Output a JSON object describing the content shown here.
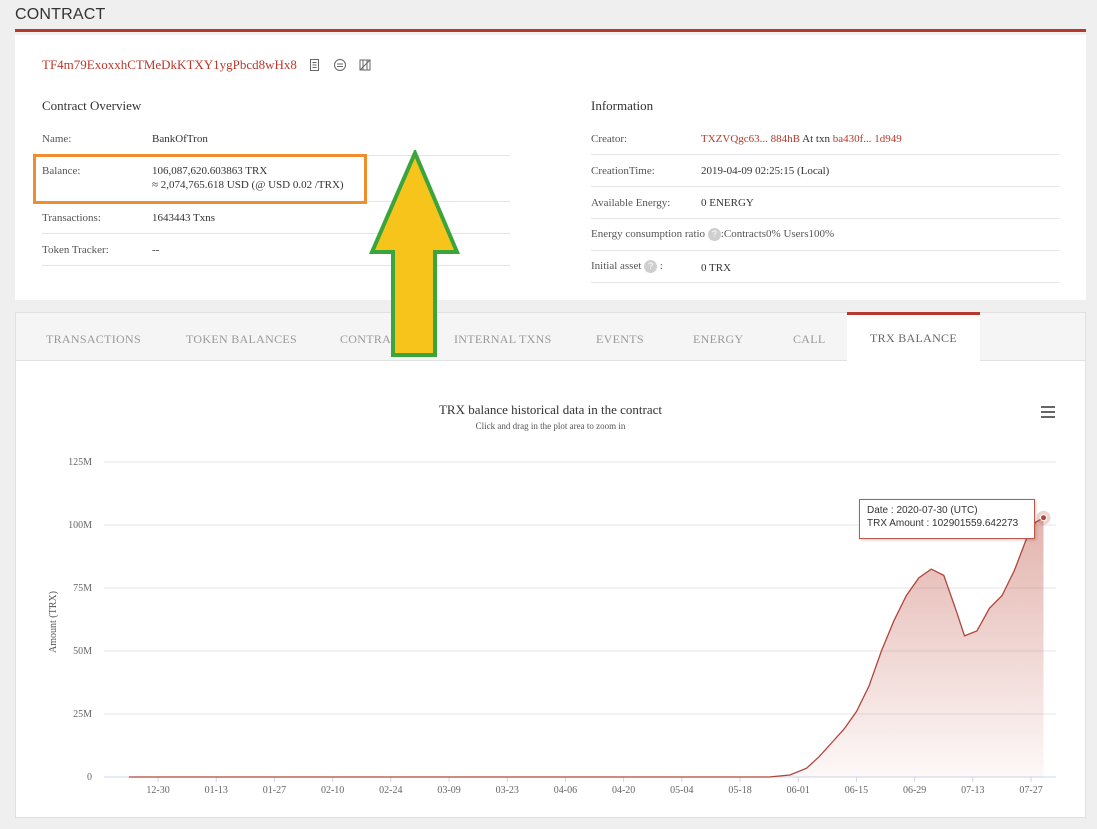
{
  "header": {
    "title": "CONTRACT"
  },
  "contract": {
    "address": "TF4m79ExoxxhCTMeDkKTXY1ygPbcd8wHx8",
    "icons": [
      "copy-icon",
      "qr-code-icon",
      "tag-icon"
    ]
  },
  "overview": {
    "title": "Contract Overview",
    "name_label": "Name:",
    "name_value": "BankOfTron",
    "balance_label": "Balance:",
    "balance_trx": "106,087,620.603863 TRX",
    "balance_usd": "≈ 2,074,765.618 USD (@ USD 0.02 /TRX)",
    "transactions_label": "Transactions:",
    "transactions_value": "1643443  Txns",
    "token_tracker_label": "Token Tracker:",
    "token_tracker_value": "--"
  },
  "information": {
    "title": "Information",
    "creator_label": "Creator:",
    "creator_address": "TXZVQgc63... 884hB",
    "creator_at": "At txn",
    "creator_txn": "ba430f... 1d949",
    "creation_time_label": "CreationTime:",
    "creation_time_value": "2019-04-09 02:25:15 (Local)",
    "energy_label": "Available Energy:",
    "energy_value": "0  ENERGY",
    "ratio_label": "Energy consumption ratio",
    "ratio_value": ":Contracts0%  Users100%",
    "initial_asset_label": "Initial asset",
    "initial_asset_value": "0 TRX"
  },
  "tabs": [
    {
      "label": "TRANSACTIONS"
    },
    {
      "label": "TOKEN BALANCES"
    },
    {
      "label": "CONTRACT"
    },
    {
      "label": "INTERNAL TXNS"
    },
    {
      "label": "EVENTS"
    },
    {
      "label": "ENERGY"
    },
    {
      "label": "CALL"
    },
    {
      "label": "TRX BALANCE"
    }
  ],
  "active_tab": "TRX BALANCE",
  "colors": {
    "accent": "#b8392b",
    "highlight": "#ef8d2f",
    "arrow_fill": "#f7c41c",
    "arrow_stroke": "#3aa53a"
  },
  "chart_data": {
    "type": "area",
    "title": "TRX balance historical data in the contract",
    "subtitle": "Click and drag in the plot area to zoom in",
    "ylabel": "Amount (TRX)",
    "y_ticks": [
      "0",
      "25M",
      "50M",
      "75M",
      "100M",
      "125M"
    ],
    "ylim": [
      0,
      125000000
    ],
    "x_ticks": [
      "12-30",
      "01-13",
      "01-27",
      "02-10",
      "02-24",
      "03-09",
      "03-23",
      "04-06",
      "04-20",
      "05-04",
      "05-18",
      "06-01",
      "06-15",
      "06-29",
      "07-13",
      "07-27"
    ],
    "series": [
      {
        "x": [
          "2019-12-23",
          "2020-05-25",
          "2020-05-30",
          "2020-06-03",
          "2020-06-06",
          "2020-06-09",
          "2020-06-12",
          "2020-06-15",
          "2020-06-18",
          "2020-06-21",
          "2020-06-24",
          "2020-06-27",
          "2020-06-30",
          "2020-07-03",
          "2020-07-06",
          "2020-07-09",
          "2020-07-11",
          "2020-07-14",
          "2020-07-17",
          "2020-07-20",
          "2020-07-23",
          "2020-07-26",
          "2020-07-28",
          "2020-07-30"
        ],
        "y": [
          0,
          0,
          800000,
          3500000,
          8000000,
          13500000,
          19000000,
          26000000,
          36000000,
          50000000,
          62000000,
          72000000,
          79000000,
          82500000,
          80000000,
          66000000,
          56000000,
          58000000,
          67000000,
          72000000,
          82000000,
          95000000,
          101000000,
          102901559.642273
        ]
      }
    ]
  },
  "tooltip": {
    "date_line": "Date : 2020-07-30 (UTC)",
    "amount_line": "TRX Amount : 102901559.642273"
  }
}
